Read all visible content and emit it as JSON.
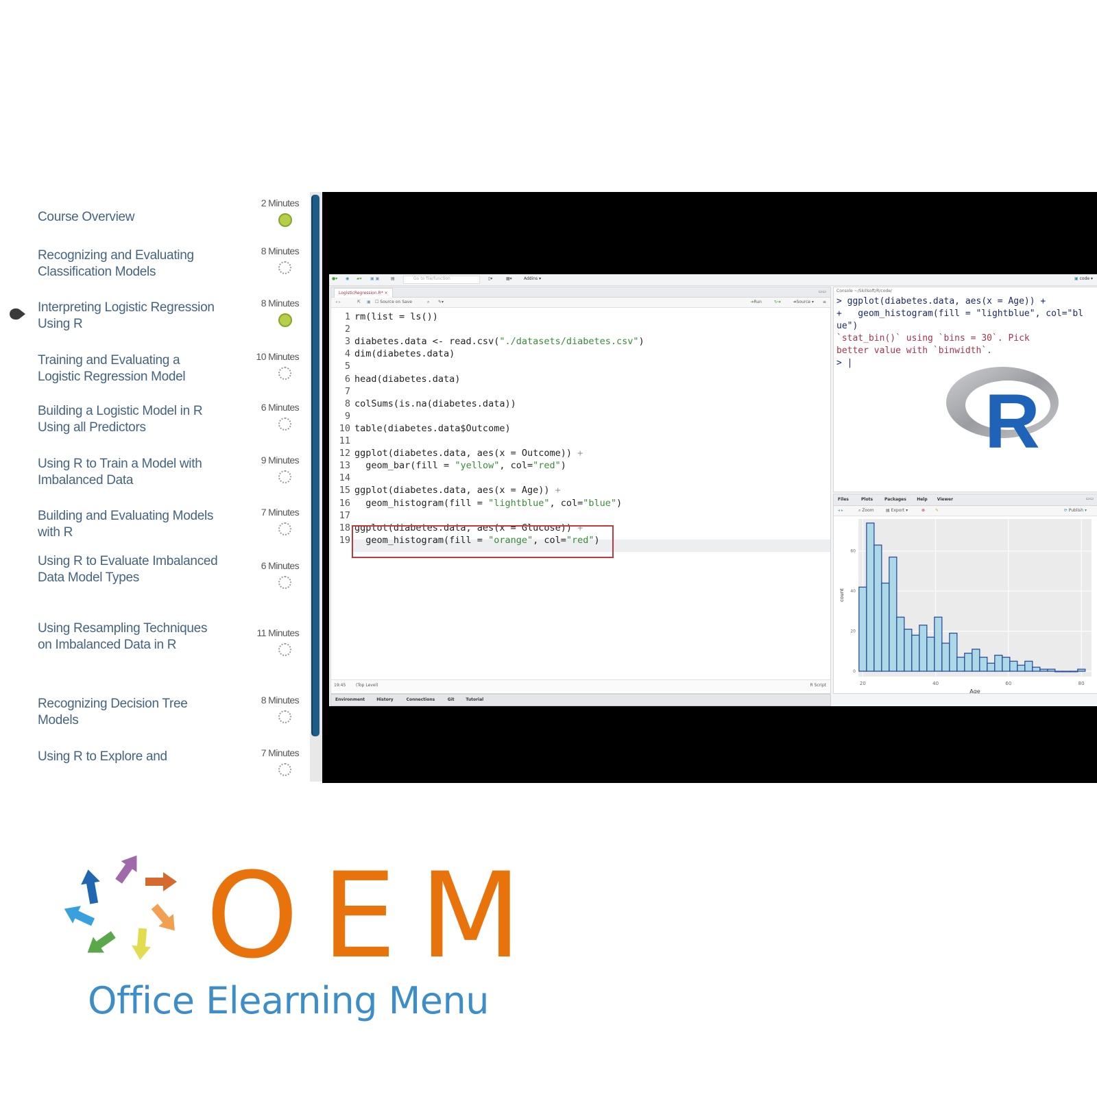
{
  "course_list": {
    "items": [
      {
        "title": "Course Overview",
        "duration": "2 Minutes",
        "status": "completed"
      },
      {
        "title": "Recognizing and Evaluating Classification Models",
        "duration": "8 Minutes",
        "status": "not-started"
      },
      {
        "title": "Interpreting Logistic Regression Using R",
        "duration": "8 Minutes",
        "status": "completed",
        "current": true
      },
      {
        "title": "Training and Evaluating a Logistic Regression Model",
        "duration": "10 Minutes",
        "status": "not-started"
      },
      {
        "title": "Building a Logistic Model in R Using all Predictors",
        "duration": "6 Minutes",
        "status": "not-started"
      },
      {
        "title": "Using R to Train a Model with Imbalanced Data",
        "duration": "9 Minutes",
        "status": "not-started"
      },
      {
        "title": "Building and Evaluating Models with R",
        "duration": "7 Minutes",
        "status": "not-started"
      },
      {
        "title": "Using R to Evaluate Imbalanced Data Model Types",
        "duration": "6 Minutes",
        "status": "not-started"
      },
      {
        "title": "Using Resampling Techniques on Imbalanced Data in R",
        "duration": "11 Minutes",
        "status": "not-started"
      },
      {
        "title": "Recognizing Decision Tree Models",
        "duration": "8 Minutes",
        "status": "not-started"
      },
      {
        "title": "Using R to Explore and",
        "duration": "7 Minutes",
        "status": "not-started"
      }
    ],
    "colors": {
      "completed": "#b5cf4a",
      "title": "#44647f"
    }
  },
  "rstudio": {
    "toolbar": {
      "goto_placeholder": "Go to file/function",
      "addins_label": "Addins",
      "project_label": "code"
    },
    "editor": {
      "tab_label": "LogisticRegression.R*",
      "source_on_save_label": "Source on Save",
      "run_label": "Run",
      "source_label": "Source",
      "status_position": "19:45",
      "status_scope": "(Top Level)",
      "status_type": "R Script",
      "lines": [
        {
          "n": "1",
          "code": "rm(list = ls())"
        },
        {
          "n": "2",
          "code": ""
        },
        {
          "n": "3",
          "code": "diabetes.data <- read.csv(\"./datasets/diabetes.csv\")"
        },
        {
          "n": "4",
          "code": "dim(diabetes.data)"
        },
        {
          "n": "5",
          "code": ""
        },
        {
          "n": "6",
          "code": "head(diabetes.data)"
        },
        {
          "n": "7",
          "code": ""
        },
        {
          "n": "8",
          "code": "colSums(is.na(diabetes.data))"
        },
        {
          "n": "9",
          "code": ""
        },
        {
          "n": "10",
          "code": "table(diabetes.data$Outcome)"
        },
        {
          "n": "11",
          "code": ""
        },
        {
          "n": "12",
          "code": "ggplot(diabetes.data, aes(x = Outcome)) +"
        },
        {
          "n": "13",
          "code": "  geom_bar(fill = \"yellow\", col=\"red\")"
        },
        {
          "n": "14",
          "code": ""
        },
        {
          "n": "15",
          "code": "ggplot(diabetes.data, aes(x = Age)) +"
        },
        {
          "n": "16",
          "code": "  geom_histogram(fill = \"lightblue\", col=\"blue\")"
        },
        {
          "n": "17",
          "code": ""
        },
        {
          "n": "18",
          "code": "ggplot(diabetes.data, aes(x = Glucose)) +"
        },
        {
          "n": "19",
          "code": "  geom_histogram(fill = \"orange\", col=\"red\")"
        }
      ],
      "highlight_color": "#c0393c"
    },
    "bottom_tabs": [
      "Environment",
      "History",
      "Connections",
      "Git",
      "Tutorial"
    ],
    "console": {
      "title": "Console ~/Skillsoft/R/code/",
      "lines": [
        {
          "text": "> ggplot(diabetes.data, aes(x = Age)) +",
          "kind": "input"
        },
        {
          "text": "+   geom_histogram(fill = \"lightblue\", col=\"bl",
          "kind": "input"
        },
        {
          "text": "ue\")",
          "kind": "input"
        },
        {
          "text": "`stat_bin()` using `bins = 30`. Pick",
          "kind": "message"
        },
        {
          "text": "better value with `binwidth`.",
          "kind": "message"
        },
        {
          "text": "> |",
          "kind": "input"
        }
      ],
      "logo_letter": "R"
    },
    "plots_pane": {
      "tabs": [
        "Files",
        "Plots",
        "Packages",
        "Help",
        "Viewer"
      ],
      "toolbar": {
        "zoom_label": "Zoom",
        "export_label": "Export",
        "publish_label": "Publish"
      }
    }
  },
  "chart_data": {
    "type": "bar",
    "title": "",
    "xlabel": "Age",
    "ylabel": "count",
    "x_ticks": [
      "20",
      "40",
      "60",
      "80"
    ],
    "y_ticks": [
      "0",
      "20",
      "40",
      "60"
    ],
    "xlim": [
      20,
      82
    ],
    "ylim": [
      0,
      76
    ],
    "bin_start": 20.0,
    "bin_width": 2.07,
    "values": [
      42,
      74,
      63,
      44,
      57,
      27,
      21,
      18,
      23,
      17,
      27,
      14,
      19,
      7,
      9,
      11,
      7,
      4,
      8,
      7,
      5,
      3,
      5,
      2,
      1,
      1,
      0,
      0,
      0,
      1
    ],
    "fill": "#add8e6",
    "stroke": "#2b4f9e",
    "grid": true
  },
  "logo": {
    "letters": "OEM",
    "subtitle": "Office Elearning Menu",
    "colors": {
      "letters": "#e8720c",
      "subtitle": "#3d8dc8"
    }
  }
}
